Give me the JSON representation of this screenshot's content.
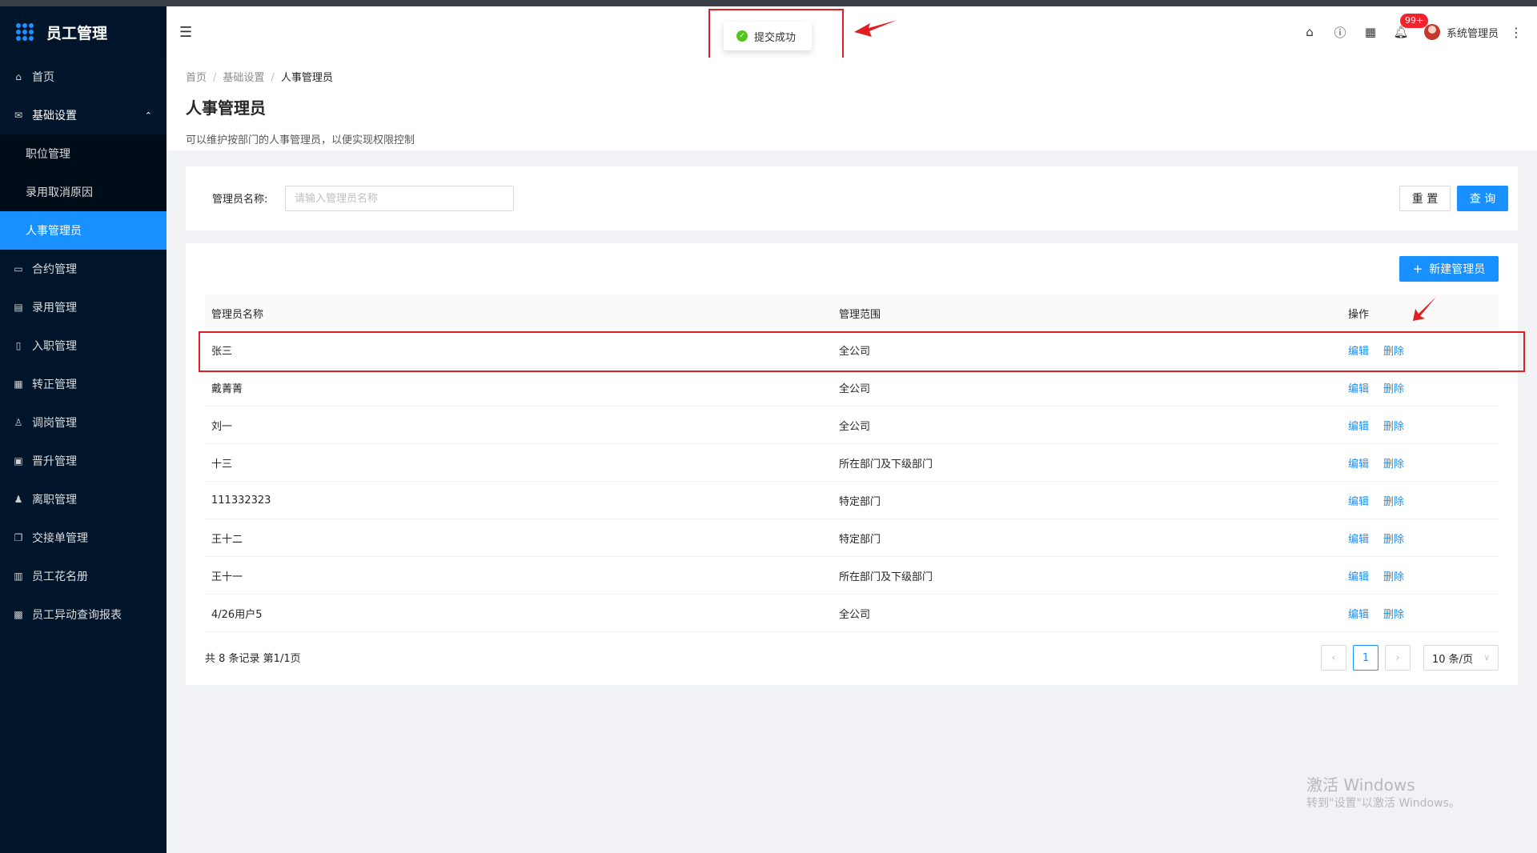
{
  "app": {
    "title": "员工管理"
  },
  "sidebar": {
    "items": [
      {
        "label": "首页",
        "icon": "home-icon"
      },
      {
        "label": "基础设置",
        "icon": "mail-icon",
        "open": true,
        "children": [
          {
            "label": "职位管理"
          },
          {
            "label": "录用取消原因"
          },
          {
            "label": "人事管理员",
            "active": true
          }
        ]
      },
      {
        "label": "合约管理",
        "icon": "calendar-icon"
      },
      {
        "label": "录用管理",
        "icon": "profile-icon"
      },
      {
        "label": "入职管理",
        "icon": "book-icon"
      },
      {
        "label": "转正管理",
        "icon": "appstore-icon"
      },
      {
        "label": "调岗管理",
        "icon": "user-icon"
      },
      {
        "label": "晋升管理",
        "icon": "container-icon"
      },
      {
        "label": "离职管理",
        "icon": "user-delete-icon"
      },
      {
        "label": "交接单管理",
        "icon": "copy-icon"
      },
      {
        "label": "员工花名册",
        "icon": "idcard-icon"
      },
      {
        "label": "员工异动查询报表",
        "icon": "table-icon"
      }
    ]
  },
  "header": {
    "notification_badge": "99+",
    "username": "系统管理员"
  },
  "toast": {
    "message": "提交成功"
  },
  "breadcrumb": [
    "首页",
    "基础设置",
    "人事管理员"
  ],
  "page": {
    "title": "人事管理员",
    "description": "可以维护按部门的人事管理员，以便实现权限控制"
  },
  "search": {
    "label": "管理员名称:",
    "placeholder": "请输入管理员名称",
    "reset_label": "重 置",
    "query_label": "查 询"
  },
  "table": {
    "new_button": "新建管理员",
    "columns": [
      "管理员名称",
      "管理范围",
      "操作"
    ],
    "rows": [
      {
        "name": "张三",
        "scope": "全公司"
      },
      {
        "name": "戴菁菁",
        "scope": "全公司"
      },
      {
        "name": "刘一",
        "scope": "全公司"
      },
      {
        "name": "十三",
        "scope": "所在部门及下级部门"
      },
      {
        "name": "111332323",
        "scope": "特定部门"
      },
      {
        "name": "王十二",
        "scope": "特定部门"
      },
      {
        "name": "王十一",
        "scope": "所在部门及下级部门"
      },
      {
        "name": "4/26用户5",
        "scope": "全公司"
      }
    ],
    "edit_label": "编辑",
    "delete_label": "删除",
    "summary": "共 8 条记录 第1/1页",
    "current_page": "1",
    "page_size": "10 条/页"
  },
  "watermark": {
    "line1": "激活 Windows",
    "line2": "转到\"设置\"以激活 Windows。"
  },
  "colors": {
    "primary": "#1890ff",
    "sidebar_bg": "#001529",
    "success": "#52c41a",
    "annotation": "#e02020"
  }
}
